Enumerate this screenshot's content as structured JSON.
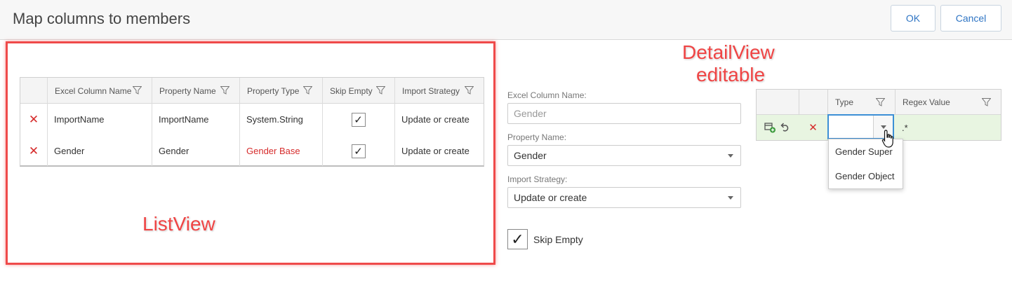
{
  "header": {
    "title": "Map columns to members",
    "ok_label": "OK",
    "cancel_label": "Cancel"
  },
  "annotations": {
    "listview": "ListView",
    "detailview_line1": "DetailView",
    "detailview_line2": "editable"
  },
  "list_grid": {
    "columns": [
      "Excel Column Name",
      "Property Name",
      "Property Type",
      "Skip Empty",
      "Import Strategy"
    ],
    "rows": [
      {
        "excel": "ImportName",
        "property": "ImportName",
        "type": "System.String",
        "skip": "✓",
        "strategy": "Update or create"
      },
      {
        "excel": "Gender",
        "property": "Gender",
        "type": "Gender Base",
        "skip": "✓",
        "strategy": "Update or create"
      }
    ]
  },
  "detail": {
    "excel_label": "Excel Column Name:",
    "excel_value": "Gender",
    "property_label": "Property Name:",
    "property_value": "Gender",
    "strategy_label": "Import Strategy:",
    "strategy_value": "Update or create",
    "skip_label": "Skip Empty",
    "skip_check": "✓"
  },
  "mini_grid": {
    "columns": [
      "Type",
      "Regex Value"
    ],
    "row": {
      "type": "",
      "regex": ".*"
    },
    "dropdown_options": [
      "Gender Super",
      "Gender Object"
    ]
  },
  "colors": {
    "accent": "#2f75c4",
    "annotation_red": "#ef4444",
    "delete_red": "#d62c2c",
    "editing_row": "#e8f5e1"
  }
}
